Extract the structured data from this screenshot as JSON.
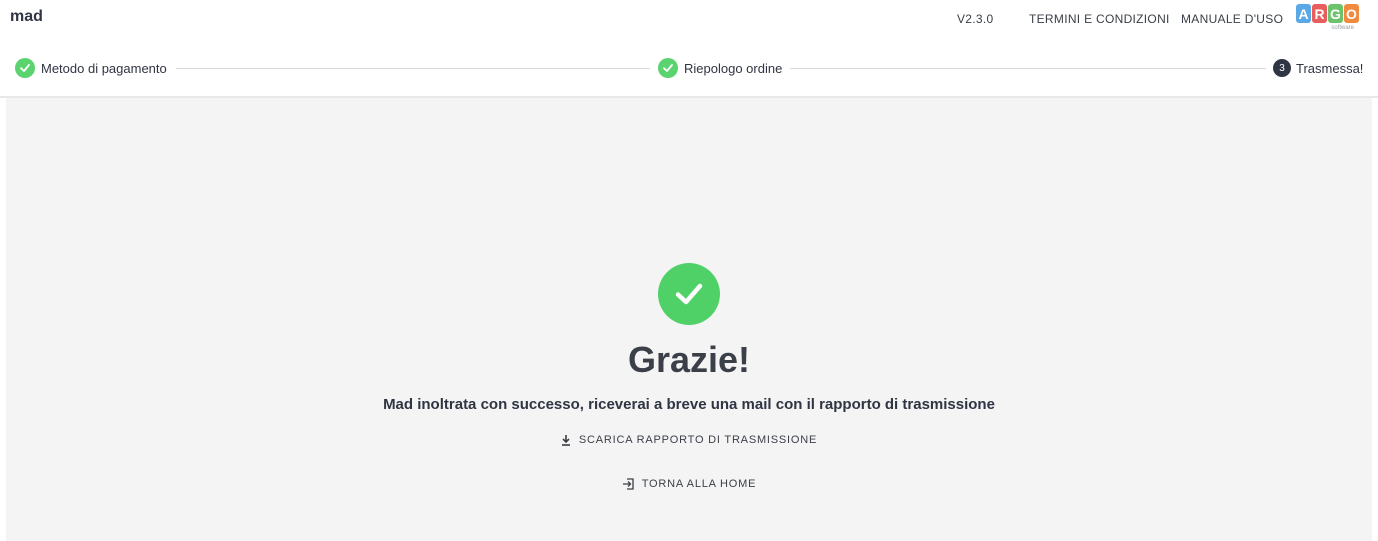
{
  "header": {
    "app_name": "mad",
    "version": "V2.3.0",
    "links": [
      "TERMINI E CONDIZIONI",
      "MANUALE D'USO"
    ],
    "logo": {
      "letters": [
        "A",
        "R",
        "G",
        "O"
      ],
      "subtitle": "software",
      "colors": [
        "#5aa9e6",
        "#e85d5d",
        "#6cc36c",
        "#f08a3e"
      ]
    }
  },
  "stepper": {
    "steps": [
      {
        "label": "Metodo di pagamento",
        "state": "done",
        "icon": "check-icon"
      },
      {
        "label": "Riepologo ordine",
        "state": "done",
        "icon": "check-icon"
      },
      {
        "label": "Trasmessa!",
        "state": "current",
        "number": "3"
      }
    ],
    "done_color": "#5bd36e"
  },
  "result": {
    "icon": "check-circle-icon",
    "title": "Grazie!",
    "message": "Mad inoltrata con successo, riceverai a breve una mail con il rapporto di trasmissione",
    "download_label": "SCARICA RAPPORTO DI TRASMISSIONE",
    "home_label": "TORNA ALLA HOME"
  }
}
